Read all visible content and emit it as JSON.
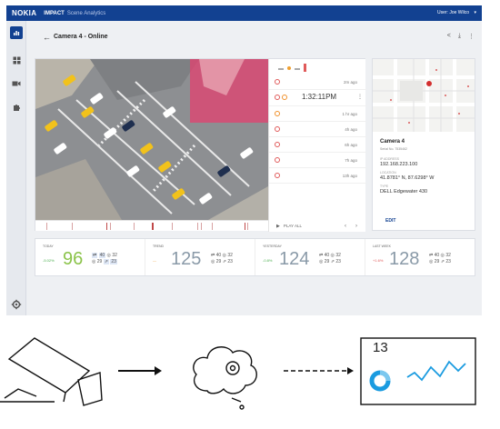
{
  "topbar": {
    "brand": "NOKIA",
    "product": "IMPACT",
    "product_sub": "Scene Analytics",
    "user": "User: Joe Wilco",
    "color": "#124191"
  },
  "page": {
    "title": "Camera 4 - Online",
    "back_icon": "arrow-left-icon"
  },
  "events": {
    "rows": [
      {
        "time": "2m ago",
        "color": "#e05a5a"
      },
      {
        "time": "1:32:11PM",
        "color": "#e05a5a"
      },
      {
        "time": "1 hr ago",
        "color": "#f0902a"
      },
      {
        "time": "4h ago",
        "color": "#e05a5a"
      },
      {
        "time": "6h ago",
        "color": "#e05a5a"
      },
      {
        "time": "7h ago",
        "color": "#e05a5a"
      },
      {
        "time": "13h ago",
        "color": "#e05a5a"
      }
    ],
    "play_all": "PLAY ALL"
  },
  "camera_info": {
    "name": "Camera 4",
    "serial": "Serial No. 7535462",
    "ip_label": "IP ADDRESS",
    "ip": "192.168.223.100",
    "location_label": "LOCATION",
    "location": "41.8781° N, 87.6298° W",
    "type_label": "TYPE",
    "type": "DELL Edgewater 430",
    "edit": "EDIT"
  },
  "stats": [
    {
      "label": "TODAY",
      "change": "-5.02%",
      "change_color": "#4caf50",
      "value": "96",
      "value_color": "#8bc34a",
      "a": "40",
      "b": "32",
      "c": "29",
      "d": "23"
    },
    {
      "label": "TREND",
      "change": "—",
      "change_color": "#f0a030",
      "value": "125",
      "value_color": "#8a9aa8",
      "a": "40",
      "b": "32",
      "c": "29",
      "d": "23"
    },
    {
      "label": "YESTERDAY",
      "change": "-0.8%",
      "change_color": "#4caf50",
      "value": "124",
      "value_color": "#8a9aa8",
      "a": "40",
      "b": "32",
      "c": "29",
      "d": "23"
    },
    {
      "label": "LAST WEEK",
      "change": "+1.6%",
      "change_color": "#e05a5a",
      "value": "128",
      "value_color": "#8a9aa8",
      "a": "40",
      "b": "32",
      "c": "29",
      "d": "23"
    }
  ],
  "illustration": {
    "dashboard_number": "13"
  }
}
